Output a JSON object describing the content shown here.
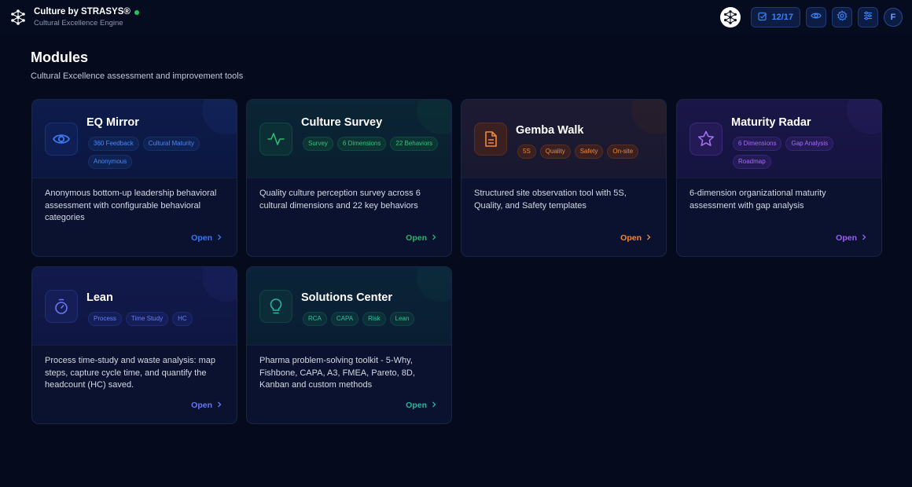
{
  "header": {
    "brand_title": "Culture by STRASYS®",
    "brand_subtitle": "Cultural Excellence Engine",
    "progress_label": "12/17",
    "avatar_initial": "F"
  },
  "page": {
    "title": "Modules",
    "subtitle": "Cultural Excellence assessment and improvement tools"
  },
  "modules": [
    {
      "title": "EQ Mirror",
      "icon": "eye-icon",
      "theme": "blue",
      "tags": [
        "360 Feedback",
        "Cultural Maturity",
        "Anonymous"
      ],
      "description": "Anonymous bottom-up leadership behavioral assessment with configurable behavioral categories",
      "open_label": "Open"
    },
    {
      "title": "Culture Survey",
      "icon": "activity-icon",
      "theme": "green",
      "tags": [
        "Survey",
        "6 Dimensions",
        "22 Behaviors"
      ],
      "description": "Quality culture perception survey across 6 cultural dimensions and 22 key behaviors",
      "open_label": "Open"
    },
    {
      "title": "Gemba Walk",
      "icon": "document-icon",
      "theme": "orange",
      "tags": [
        "5S",
        "Quality",
        "Safety",
        "On-site"
      ],
      "description": "Structured site observation tool with 5S, Quality, and Safety templates",
      "open_label": "Open"
    },
    {
      "title": "Maturity Radar",
      "icon": "star-icon",
      "theme": "purple",
      "tags": [
        "6 Dimensions",
        "Gap Analysis",
        "Roadmap"
      ],
      "description": "6-dimension organizational maturity assessment with gap analysis",
      "open_label": "Open"
    },
    {
      "title": "Lean",
      "icon": "timer-icon",
      "theme": "indigo",
      "tags": [
        "Process",
        "Time Study",
        "HC"
      ],
      "description": "Process time-study and waste analysis: map steps, capture cycle time, and quantify the headcount (HC) saved.",
      "open_label": "Open"
    },
    {
      "title": "Solutions Center",
      "icon": "lightbulb-icon",
      "theme": "teal",
      "tags": [
        "RCA",
        "CAPA",
        "Risk",
        "Lean"
      ],
      "description": "Pharma problem-solving toolkit - 5-Why, Fishbone, CAPA, A3, FMEA, Pareto, 8D, Kanban and custom methods",
      "open_label": "Open"
    }
  ]
}
